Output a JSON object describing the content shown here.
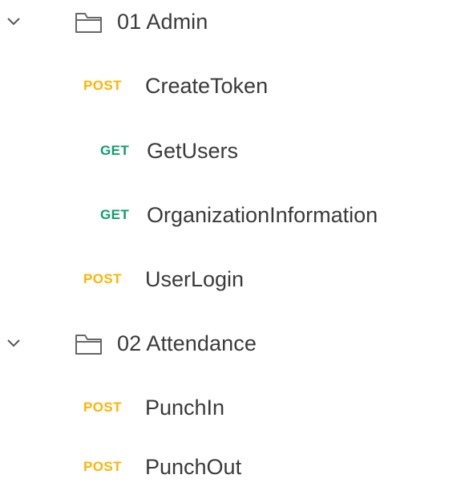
{
  "tree": {
    "folders": [
      {
        "label": "01 Admin",
        "chevron_icon": "chevron-down-icon",
        "folder_icon": "folder-icon",
        "requests": [
          {
            "method": "POST",
            "name": "CreateToken"
          },
          {
            "method": "GET",
            "name": "GetUsers"
          },
          {
            "method": "GET",
            "name": "OrganizationInformation"
          },
          {
            "method": "POST",
            "name": "UserLogin"
          }
        ]
      },
      {
        "label": "02 Attendance",
        "chevron_icon": "chevron-down-icon",
        "folder_icon": "folder-icon",
        "requests": [
          {
            "method": "POST",
            "name": "PunchIn"
          },
          {
            "method": "POST",
            "name": "PunchOut"
          }
        ]
      }
    ]
  },
  "colors": {
    "post": "#ffb400",
    "get": "#0c9f6d",
    "text": "#3a3a3a",
    "icon": "#666666"
  }
}
